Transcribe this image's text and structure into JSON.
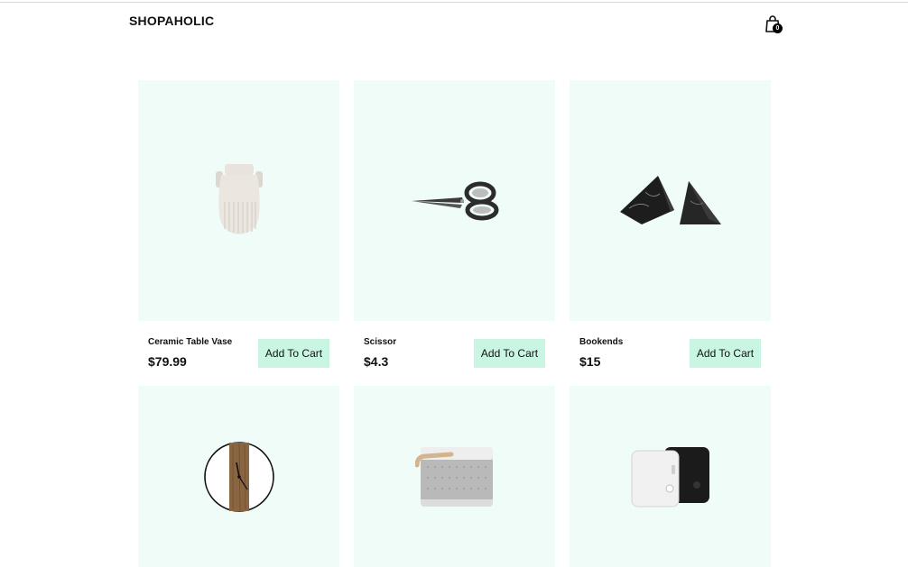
{
  "header": {
    "brand": "SHOPAHOLIC",
    "cart_count": "0",
    "cart_icon": "shopping-bag-icon"
  },
  "products": [
    {
      "name": "Ceramic Table Vase",
      "price": "$79.99",
      "button_label": "Add To Cart",
      "image": "ceramic-vase-image"
    },
    {
      "name": "Scissor",
      "price": "$4.3",
      "button_label": "Add To Cart",
      "image": "scissor-image"
    },
    {
      "name": "Bookends",
      "price": "$15",
      "button_label": "Add To Cart",
      "image": "bookends-image"
    },
    {
      "image": "wall-clock-image"
    },
    {
      "image": "bluetooth-speaker-image"
    },
    {
      "image": "white-black-devices-image"
    }
  ],
  "colors": {
    "card_background": "#effcf8",
    "button_background": "#c9f5e3",
    "text": "#111111"
  }
}
